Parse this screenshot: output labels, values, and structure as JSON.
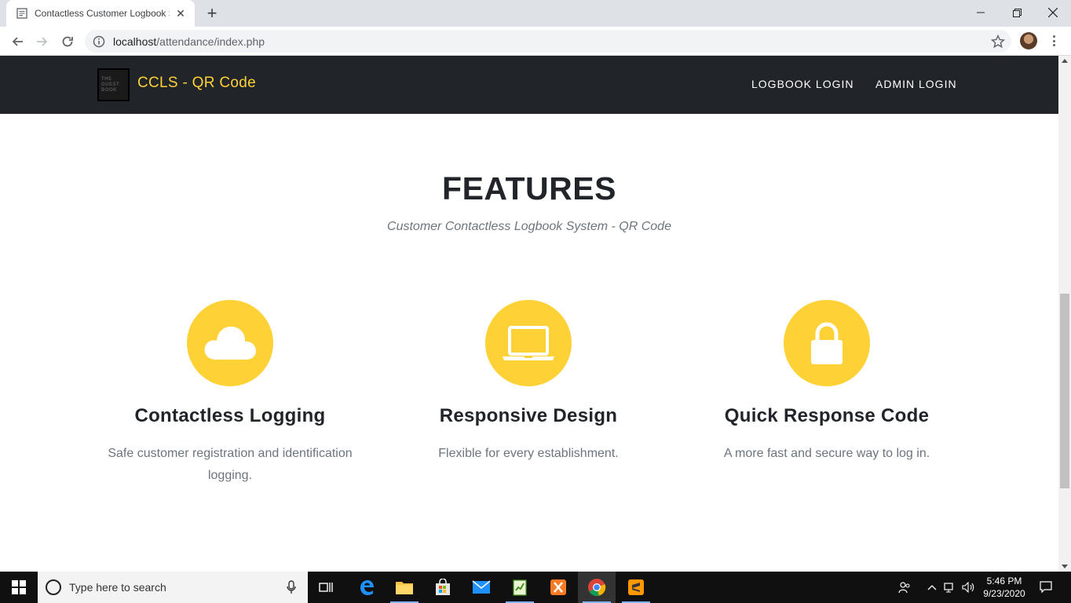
{
  "browser": {
    "tab_title": "Contactless Customer Logbook S",
    "url_host": "localhost",
    "url_path": "/attendance/index.php"
  },
  "site": {
    "brand_logo_lines": [
      "THE",
      "GUEST",
      "BOOK"
    ],
    "brand_name": "CCLS - QR Code",
    "nav_links": [
      "LOGBOOK LOGIN",
      "ADMIN LOGIN"
    ],
    "accent_color": "#fed136"
  },
  "features": {
    "title": "FEATURES",
    "subtitle": "Customer Contactless Logbook System - QR Code",
    "items": [
      {
        "icon": "cloud-icon",
        "title": "Contactless Logging",
        "description": "Safe customer registration and identification logging."
      },
      {
        "icon": "laptop-icon",
        "title": "Responsive Design",
        "description": "Flexible for every establishment."
      },
      {
        "icon": "lock-icon",
        "title": "Quick Response Code",
        "description": "A more fast and secure way to log in."
      }
    ]
  },
  "taskbar": {
    "search_placeholder": "Type here to search",
    "time": "5:46 PM",
    "date": "9/23/2020"
  }
}
